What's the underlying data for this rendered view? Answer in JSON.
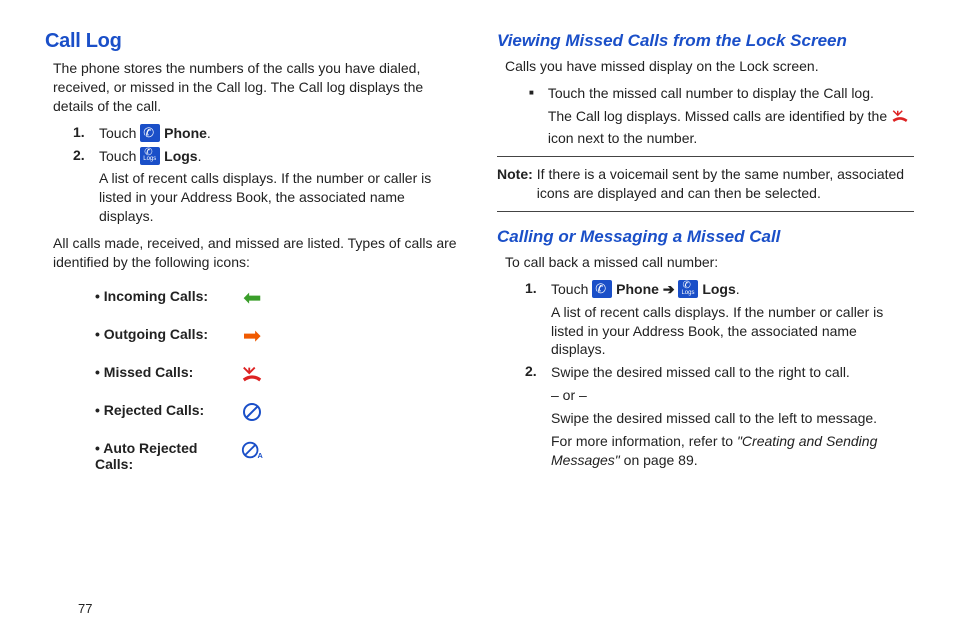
{
  "left": {
    "heading": "Call Log",
    "intro": "The phone stores the numbers of the calls you have dialed, received, or missed in the Call log. The Call log displays the details of the call.",
    "step1_prefix": "Touch ",
    "step1_bold": "Phone",
    "step1_suffix": ".",
    "step2_prefix": "Touch ",
    "step2_bold": "Logs",
    "step2_suffix": ".",
    "step2_body": "A list of recent calls displays. If the number or caller is listed in your Address Book, the associated name displays.",
    "mid": "All calls made, received, and missed are listed. Types of calls are identified by the following icons:",
    "types": {
      "incoming": "Incoming Calls",
      "outgoing": "Outgoing Calls",
      "missed": "Missed Calls",
      "rejected": "Rejected Calls",
      "autorejected": "Auto Rejected Calls"
    }
  },
  "right": {
    "h1": "Viewing Missed Calls from the Lock Screen",
    "p1": "Calls you have missed display on the Lock screen.",
    "b1": "Touch the missed call number to display the Call log.",
    "b1_sub_a": "The Call log displays. Missed calls are identified by the ",
    "b1_sub_b": " icon next to the number.",
    "note_label": "Note:",
    "note_body": "If there is a voicemail sent by the same number, associated icons are displayed and can then be selected.",
    "h2": "Calling or Messaging a Missed Call",
    "p2": "To call back a missed call number:",
    "s1_prefix": "Touch ",
    "s1_phone": "Phone",
    "s1_arrow": " ➔ ",
    "s1_logs": "Logs",
    "s1_suffix": ".",
    "s1_body": "A list of recent calls displays. If the number or caller is listed in your Address Book, the associated name displays.",
    "s2_a": "Swipe the desired missed call to the right to call.",
    "s2_or": "– or –",
    "s2_b": "Swipe the desired missed call to the left to message.",
    "s2_ref_a": "For more information, refer to ",
    "s2_ref_i": "\"Creating and Sending Messages\" ",
    "s2_ref_b": " on page 89."
  },
  "page": "77"
}
